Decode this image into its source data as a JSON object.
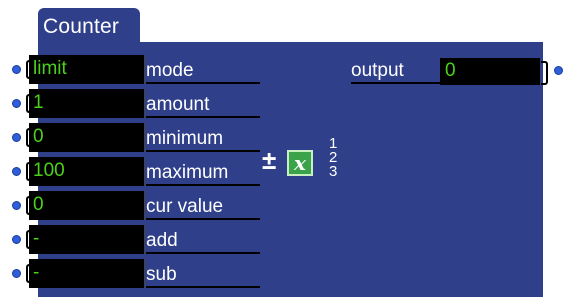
{
  "node": {
    "title": "Counter",
    "inputs": [
      {
        "value": "limit",
        "label": "mode"
      },
      {
        "value": "1",
        "label": "amount"
      },
      {
        "value": "0",
        "label": "minimum"
      },
      {
        "value": "100",
        "label": "maximum"
      },
      {
        "value": "0",
        "label": "cur value"
      },
      {
        "value": "-",
        "label": "add"
      },
      {
        "value": "-",
        "label": "sub"
      }
    ],
    "output": {
      "label": "output",
      "value": "0"
    },
    "glyphs": {
      "plus_minus": "±",
      "x": "x",
      "nums": [
        "1",
        "2",
        "3"
      ]
    }
  },
  "colors": {
    "panel": "#2f3f8a",
    "value_text": "#4cd11b",
    "port": "#2f5ed8"
  },
  "icons": [
    "inlet-port-icon",
    "outlet-port-icon",
    "plus-minus-icon",
    "math-x-icon",
    "index-numbers-icon"
  ]
}
